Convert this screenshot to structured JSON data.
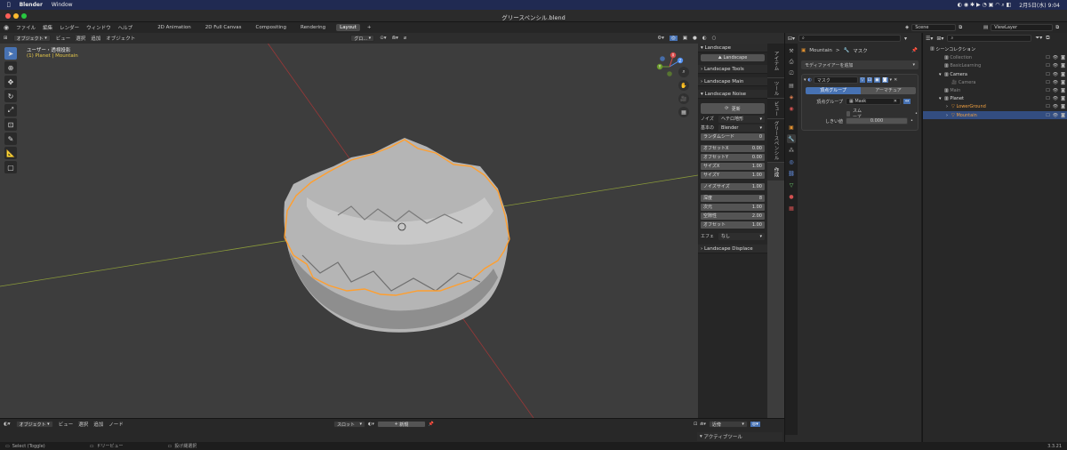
{
  "mac_menu": {
    "apple": "",
    "app": "Blender",
    "window": "Window",
    "datetime": "2月5日(水) 9:04"
  },
  "window_title": "グリースペンシル.blend",
  "main_menu": {
    "items": [
      "ファイル",
      "編集",
      "レンダー",
      "ウィンドウ",
      "ヘルプ"
    ],
    "workspaces": [
      "2D Animation",
      "2D Full Canvas",
      "Compositing",
      "Rendering",
      "Layout"
    ],
    "add_tab": "+",
    "scene": "Scene",
    "view_layer": "ViewLayer"
  },
  "viewport": {
    "mode": "オブジェクト",
    "menu": [
      "ビュー",
      "選択",
      "追加",
      "オブジェクト"
    ],
    "transform": "グロ...",
    "overlay_title": "ユーザー・透視投影",
    "overlay_sub": "(1) Planet | Mountain",
    "axis_x": "X",
    "axis_y": "Y",
    "axis_z": "Z"
  },
  "npanel": {
    "landscape_header": "Landscape",
    "landscape_button": "Landscape",
    "tools": "Landscape Tools",
    "main": "Landscape Main",
    "noise": "Landscape Noise",
    "refresh": "更新",
    "noise_label": "ノイズ",
    "noise_value": "ヘテロ地形",
    "basis_label": "基本の",
    "basis_value": "Blender",
    "random_seed_label": "ランダムシード",
    "random_seed_value": "0",
    "rows1": [
      {
        "label": "オフセットX",
        "value": "0.00"
      },
      {
        "label": "オフセットY",
        "value": "0.00"
      },
      {
        "label": "サイズX",
        "value": "1.00"
      },
      {
        "label": "サイズY",
        "value": "1.00"
      }
    ],
    "noise_size_label": "ノイズサイズ",
    "noise_size_value": "1.00",
    "rows2": [
      {
        "label": "深度",
        "value": "8"
      },
      {
        "label": "次元",
        "value": "1.00"
      },
      {
        "label": "空隙性",
        "value": "2.00"
      },
      {
        "label": "オフセット",
        "value": "1.00"
      }
    ],
    "effect_label": "エフェ",
    "effect_value": "なし",
    "displace": "Landscape Displace",
    "tabs": [
      "アイテム",
      "ツール",
      "ビュー",
      "グリースペンシル",
      "作成"
    ]
  },
  "properties": {
    "search_placeholder": "",
    "breadcrumb_object": "Mountain",
    "breadcrumb_sep": ">",
    "breadcrumb_modifier": "マスク",
    "add_modifier": "モディファイアーを追加",
    "modifier_name": "マスク",
    "tab_vertex_group": "頂点グループ",
    "tab_armature": "アーマチュア",
    "vertex_group_label": "頂点グループ",
    "vertex_group_value": "Mask",
    "smooth_label": "スムーズ",
    "threshold_label": "しきい値",
    "threshold_value": "0.000"
  },
  "outliner": {
    "root": "シーンコレクション",
    "items": [
      {
        "name": "Collection",
        "indent": 1
      },
      {
        "name": "BasicLearning",
        "indent": 1
      },
      {
        "name": "Camera",
        "indent": 1
      },
      {
        "name": "Camera",
        "indent": 2
      },
      {
        "name": "Main",
        "indent": 1
      },
      {
        "name": "Planet",
        "indent": 1
      },
      {
        "name": "LowerGround",
        "indent": 2
      },
      {
        "name": "Mountain",
        "indent": 2
      }
    ]
  },
  "timeline": {
    "mode": "オブジェクト",
    "menu": [
      "ビュー",
      "選択",
      "追加",
      "ノード"
    ],
    "slot": "スロット",
    "new": "新規",
    "proximity": "近傍",
    "active_tool": "アクティブツール"
  },
  "statusbar": {
    "select": "Select (Toggle)",
    "dolly": "ドリービュー",
    "lasso": "投げ縄選択",
    "version": "3.3.21"
  },
  "colors": {
    "accent": "#4772b3",
    "selection": "#334d80",
    "orange": "#ff9f2f",
    "mac_bar": "#202a52"
  }
}
